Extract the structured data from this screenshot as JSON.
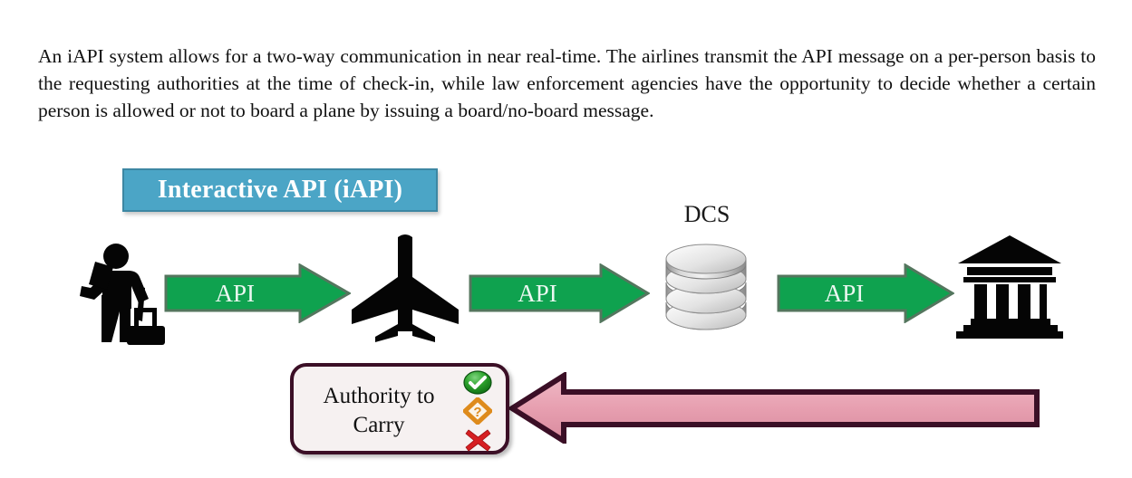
{
  "paragraph": {
    "text": "An iAPI system allows for a two-way communication in near real-time. The airlines transmit the API message on a per-person basis to the requesting authorities at the time of check-in, while law enforcement agencies have the opportunity to decide whether a certain person is allowed or not to board a plane by issuing a board/no-board message."
  },
  "diagram": {
    "banner": {
      "label": "Interactive API (iAPI)",
      "fill_color": "#4BA5C6",
      "border_color": "#3D87A3",
      "text_color": "#FFFFFF"
    },
    "nodes": [
      {
        "name": "traveller",
        "icon": "traveller-with-luggage-icon",
        "label": ""
      },
      {
        "name": "airplane",
        "icon": "airplane-icon",
        "label": ""
      },
      {
        "name": "dcs",
        "icon": "database-icon",
        "label": "DCS"
      },
      {
        "name": "authority",
        "icon": "government-building-icon",
        "label": ""
      }
    ],
    "dcs_label": "DCS",
    "api_arrows": [
      {
        "label": "API",
        "direction": "right"
      },
      {
        "label": "API",
        "direction": "right"
      },
      {
        "label": "API",
        "direction": "right"
      }
    ],
    "api_arrow_colors": {
      "fill": "#0FA24F",
      "border": "#54765E",
      "text": "#EAF7F0"
    },
    "authority_to_carry": {
      "line1": "Authority to",
      "line2": "Carry",
      "fill_color": "#F6F1F1",
      "border_color": "#3B0F26",
      "status_icons": [
        {
          "name": "green-check-icon",
          "meaning": "allowed",
          "color": "#1E8B1E"
        },
        {
          "name": "orange-question-icon",
          "meaning": "unknown",
          "color": "#E08A1E"
        },
        {
          "name": "red-cross-icon",
          "meaning": "denied",
          "color": "#D61F22"
        }
      ]
    },
    "return_arrow": {
      "label": "",
      "direction": "left",
      "fill_color": "#E8A3B2",
      "border_color": "#3B0F26"
    }
  }
}
